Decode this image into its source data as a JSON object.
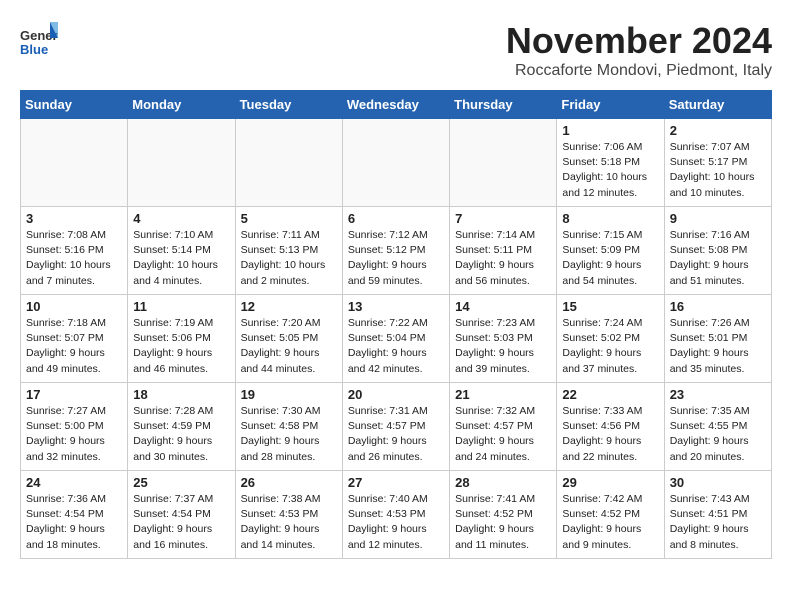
{
  "header": {
    "logo_text_general": "General",
    "logo_text_blue": "Blue",
    "month_title": "November 2024",
    "location": "Roccaforte Mondovi, Piedmont, Italy"
  },
  "weekdays": [
    "Sunday",
    "Monday",
    "Tuesday",
    "Wednesday",
    "Thursday",
    "Friday",
    "Saturday"
  ],
  "weeks": [
    [
      {
        "day": "",
        "info": ""
      },
      {
        "day": "",
        "info": ""
      },
      {
        "day": "",
        "info": ""
      },
      {
        "day": "",
        "info": ""
      },
      {
        "day": "",
        "info": ""
      },
      {
        "day": "1",
        "info": "Sunrise: 7:06 AM\nSunset: 5:18 PM\nDaylight: 10 hours and 12 minutes."
      },
      {
        "day": "2",
        "info": "Sunrise: 7:07 AM\nSunset: 5:17 PM\nDaylight: 10 hours and 10 minutes."
      }
    ],
    [
      {
        "day": "3",
        "info": "Sunrise: 7:08 AM\nSunset: 5:16 PM\nDaylight: 10 hours and 7 minutes."
      },
      {
        "day": "4",
        "info": "Sunrise: 7:10 AM\nSunset: 5:14 PM\nDaylight: 10 hours and 4 minutes."
      },
      {
        "day": "5",
        "info": "Sunrise: 7:11 AM\nSunset: 5:13 PM\nDaylight: 10 hours and 2 minutes."
      },
      {
        "day": "6",
        "info": "Sunrise: 7:12 AM\nSunset: 5:12 PM\nDaylight: 9 hours and 59 minutes."
      },
      {
        "day": "7",
        "info": "Sunrise: 7:14 AM\nSunset: 5:11 PM\nDaylight: 9 hours and 56 minutes."
      },
      {
        "day": "8",
        "info": "Sunrise: 7:15 AM\nSunset: 5:09 PM\nDaylight: 9 hours and 54 minutes."
      },
      {
        "day": "9",
        "info": "Sunrise: 7:16 AM\nSunset: 5:08 PM\nDaylight: 9 hours and 51 minutes."
      }
    ],
    [
      {
        "day": "10",
        "info": "Sunrise: 7:18 AM\nSunset: 5:07 PM\nDaylight: 9 hours and 49 minutes."
      },
      {
        "day": "11",
        "info": "Sunrise: 7:19 AM\nSunset: 5:06 PM\nDaylight: 9 hours and 46 minutes."
      },
      {
        "day": "12",
        "info": "Sunrise: 7:20 AM\nSunset: 5:05 PM\nDaylight: 9 hours and 44 minutes."
      },
      {
        "day": "13",
        "info": "Sunrise: 7:22 AM\nSunset: 5:04 PM\nDaylight: 9 hours and 42 minutes."
      },
      {
        "day": "14",
        "info": "Sunrise: 7:23 AM\nSunset: 5:03 PM\nDaylight: 9 hours and 39 minutes."
      },
      {
        "day": "15",
        "info": "Sunrise: 7:24 AM\nSunset: 5:02 PM\nDaylight: 9 hours and 37 minutes."
      },
      {
        "day": "16",
        "info": "Sunrise: 7:26 AM\nSunset: 5:01 PM\nDaylight: 9 hours and 35 minutes."
      }
    ],
    [
      {
        "day": "17",
        "info": "Sunrise: 7:27 AM\nSunset: 5:00 PM\nDaylight: 9 hours and 32 minutes."
      },
      {
        "day": "18",
        "info": "Sunrise: 7:28 AM\nSunset: 4:59 PM\nDaylight: 9 hours and 30 minutes."
      },
      {
        "day": "19",
        "info": "Sunrise: 7:30 AM\nSunset: 4:58 PM\nDaylight: 9 hours and 28 minutes."
      },
      {
        "day": "20",
        "info": "Sunrise: 7:31 AM\nSunset: 4:57 PM\nDaylight: 9 hours and 26 minutes."
      },
      {
        "day": "21",
        "info": "Sunrise: 7:32 AM\nSunset: 4:57 PM\nDaylight: 9 hours and 24 minutes."
      },
      {
        "day": "22",
        "info": "Sunrise: 7:33 AM\nSunset: 4:56 PM\nDaylight: 9 hours and 22 minutes."
      },
      {
        "day": "23",
        "info": "Sunrise: 7:35 AM\nSunset: 4:55 PM\nDaylight: 9 hours and 20 minutes."
      }
    ],
    [
      {
        "day": "24",
        "info": "Sunrise: 7:36 AM\nSunset: 4:54 PM\nDaylight: 9 hours and 18 minutes."
      },
      {
        "day": "25",
        "info": "Sunrise: 7:37 AM\nSunset: 4:54 PM\nDaylight: 9 hours and 16 minutes."
      },
      {
        "day": "26",
        "info": "Sunrise: 7:38 AM\nSunset: 4:53 PM\nDaylight: 9 hours and 14 minutes."
      },
      {
        "day": "27",
        "info": "Sunrise: 7:40 AM\nSunset: 4:53 PM\nDaylight: 9 hours and 12 minutes."
      },
      {
        "day": "28",
        "info": "Sunrise: 7:41 AM\nSunset: 4:52 PM\nDaylight: 9 hours and 11 minutes."
      },
      {
        "day": "29",
        "info": "Sunrise: 7:42 AM\nSunset: 4:52 PM\nDaylight: 9 hours and 9 minutes."
      },
      {
        "day": "30",
        "info": "Sunrise: 7:43 AM\nSunset: 4:51 PM\nDaylight: 9 hours and 8 minutes."
      }
    ]
  ]
}
